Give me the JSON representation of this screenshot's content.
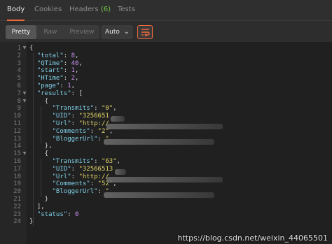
{
  "tabs": {
    "body": "Body",
    "cookies": "Cookies",
    "headers": "Headers",
    "headers_count": "(6)",
    "tests": "Tests"
  },
  "toolbar": {
    "pretty": "Pretty",
    "raw": "Raw",
    "preview": "Preview",
    "format": "Auto",
    "format_chevron": "⌄",
    "wrap_icon": "wrap-lines-icon"
  },
  "colors": {
    "accent": "#f26b3a",
    "key": "#7fd0e8",
    "string": "#e4d66a",
    "number": "#c78cf0"
  },
  "code": {
    "line_numbers": [
      "1",
      "2",
      "3",
      "4",
      "5",
      "6",
      "7",
      "8",
      "9",
      "10",
      "11",
      "12",
      "13",
      "14",
      "15",
      "16",
      "17",
      "18",
      "19",
      "20",
      "21",
      "22",
      "23",
      "24"
    ],
    "lines": [
      "{",
      "  \"total\": 8,",
      "  \"QTime\": 40,",
      "  \"start\": 1,",
      "  \"HTime\": 2,",
      "  \"page\": 1,",
      "  \"results\": [",
      "    {",
      "      \"Transmits\": \"0\",",
      "      \"UID\": \"3256651",
      "      \"Url\": \"http://",
      "      \"Comments\": \"2\",",
      "      \"BloggerUrl\": \"",
      "    },",
      "    {",
      "      \"Transmits\": \"63\",",
      "      \"UID\": \"32566513",
      "      \"Url\": \"http://",
      "      \"Comments\": \"52\",",
      "      \"BloggerUrl\": \"",
      "    }",
      "  ],",
      "  \"status\": 0",
      "}"
    ]
  },
  "watermark": "https://blog.csdn.net/weixin_44065501"
}
